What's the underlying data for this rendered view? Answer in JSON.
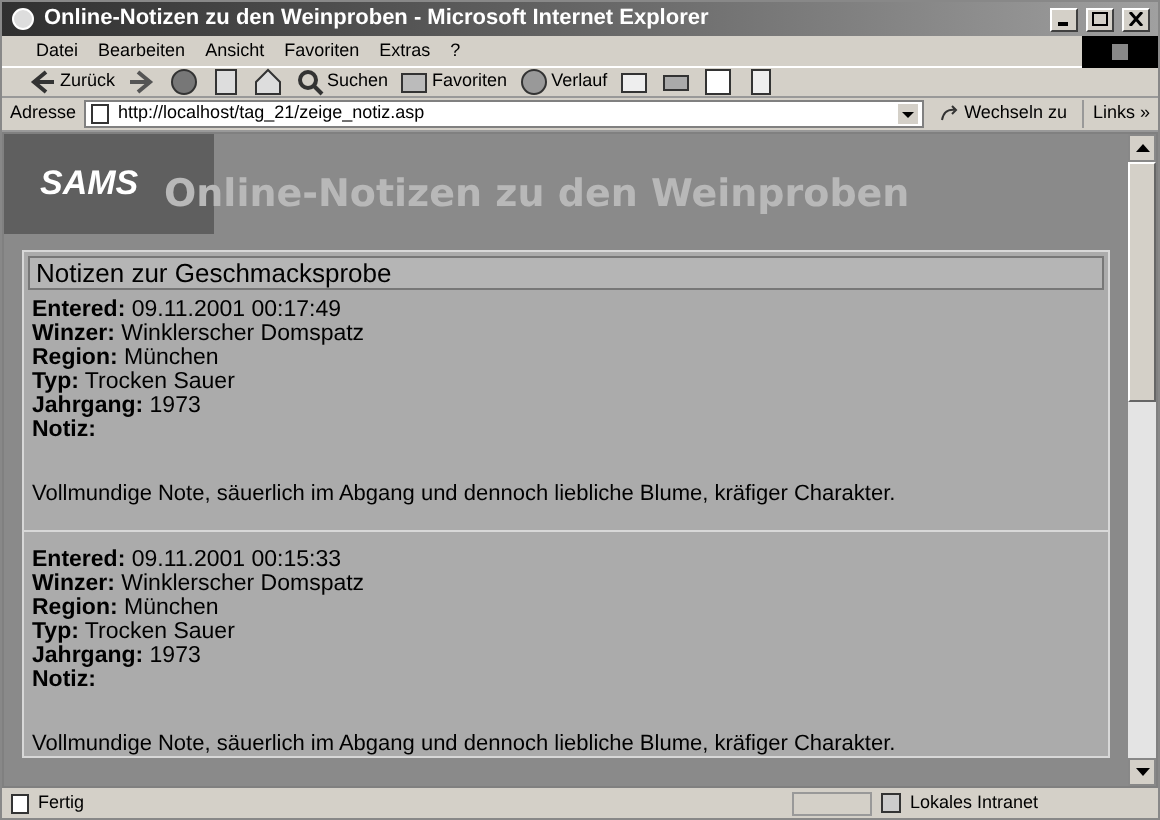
{
  "window": {
    "title": "Online-Notizen zu den Weinproben - Microsoft Internet Explorer"
  },
  "menu": [
    "Datei",
    "Bearbeiten",
    "Ansicht",
    "Favoriten",
    "Extras",
    "?"
  ],
  "toolbar": [
    {
      "kind": "back",
      "label": "Zurück"
    },
    {
      "kind": "forward"
    },
    {
      "kind": "stop"
    },
    {
      "kind": "refresh"
    },
    {
      "kind": "home"
    },
    {
      "kind": "search",
      "label": "Suchen"
    },
    {
      "kind": "favorites",
      "label": "Favoriten"
    },
    {
      "kind": "history",
      "label": "Verlauf"
    },
    {
      "kind": "mail"
    },
    {
      "kind": "print"
    },
    {
      "kind": "edit"
    },
    {
      "kind": "discuss"
    }
  ],
  "address": {
    "label": "Adresse",
    "value": "http://localhost/tag_21/zeige_notiz.asp",
    "go": "Wechseln zu",
    "links": "Links",
    "chevron": "»"
  },
  "banner": {
    "logo": "SAMS",
    "title": "Online-Notizen zu den Weinproben"
  },
  "panel": {
    "heading": "Notizen zur Geschmacksprobe",
    "entries": [
      {
        "fields": [
          {
            "label": "Entered:",
            "value": "09.11.2001 00:17:49"
          },
          {
            "label": "Winzer:",
            "value": "Winklerscher Domspatz"
          },
          {
            "label": "Region:",
            "value": "München"
          },
          {
            "label": "Typ:",
            "value": "Trocken Sauer"
          },
          {
            "label": "Jahrgang:",
            "value": "1973"
          },
          {
            "label": "Notiz:"
          }
        ],
        "note": "Vollmundige Note, säuerlich im Abgang und dennoch liebliche Blume, kräfiger Charakter."
      },
      {
        "fields": [
          {
            "label": "Entered:",
            "value": "09.11.2001 00:15:33"
          },
          {
            "label": "Winzer:",
            "value": "Winklerscher Domspatz"
          },
          {
            "label": "Region:",
            "value": "München"
          },
          {
            "label": "Typ:",
            "value": "Trocken Sauer"
          },
          {
            "label": "Jahrgang:",
            "value": "1973"
          },
          {
            "label": "Notiz:"
          }
        ],
        "note": "Vollmundige Note, säuerlich im Abgang und dennoch liebliche Blume, kräfiger Charakter."
      }
    ]
  },
  "status": {
    "text": "Fertig",
    "zone": "Lokales Intranet"
  }
}
